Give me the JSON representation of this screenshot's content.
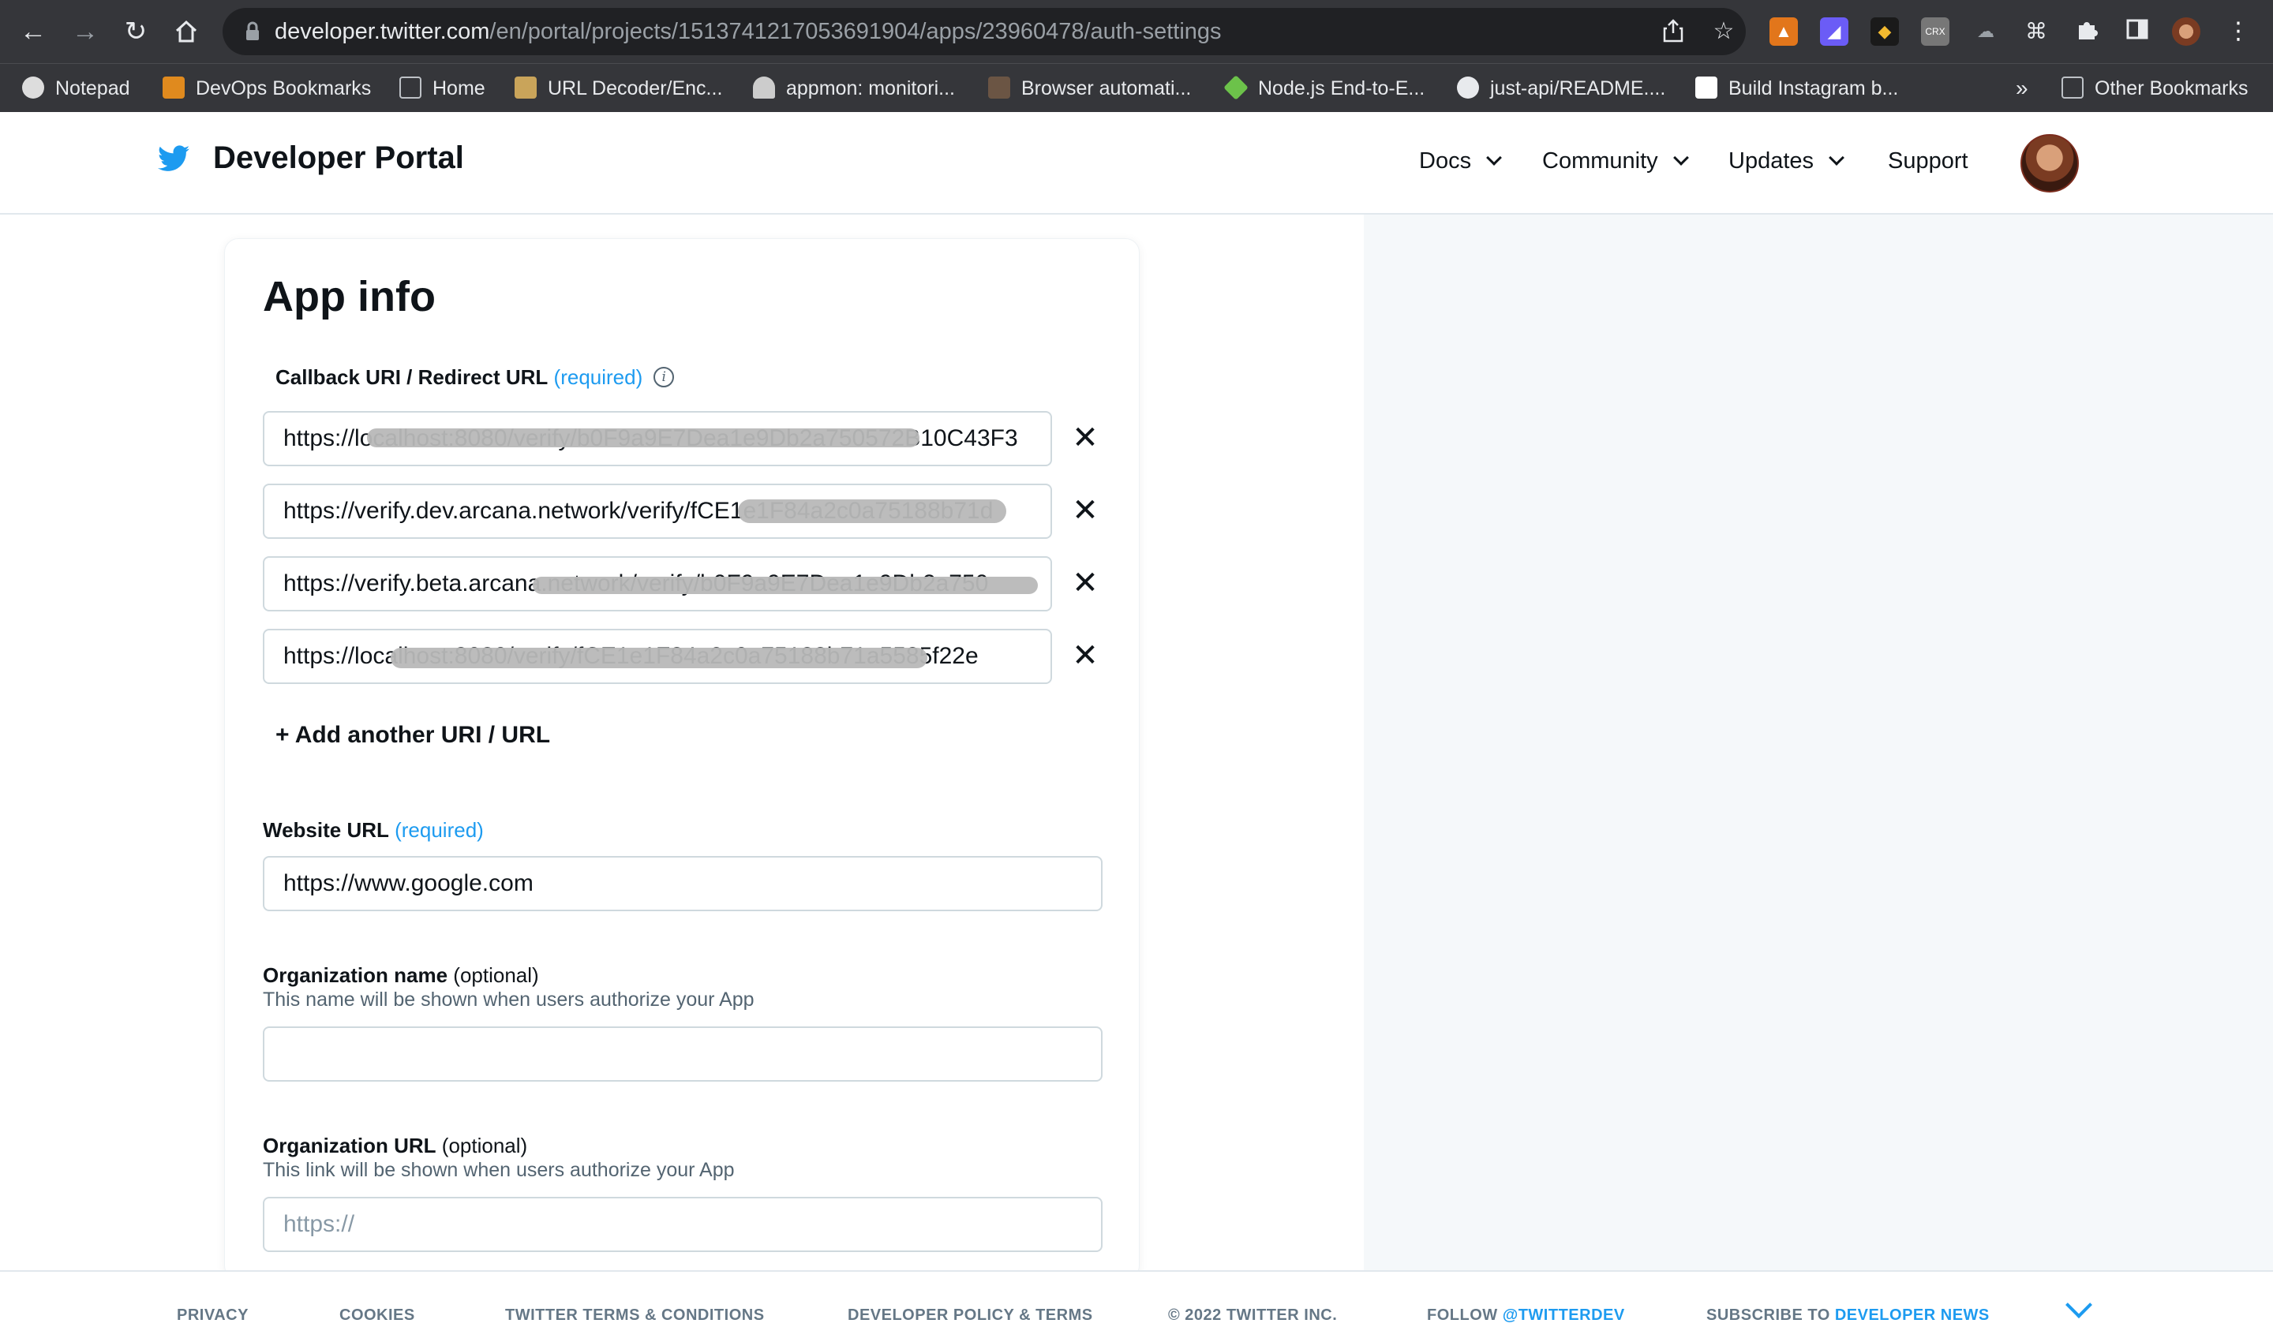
{
  "browser": {
    "url_host": "developer.twitter.com",
    "url_path": "/en/portal/projects/1513741217053691904/apps/23960478/auth-settings",
    "bookmarks": [
      {
        "label": "Notepad"
      },
      {
        "label": "DevOps Bookmarks"
      },
      {
        "label": "Home"
      },
      {
        "label": "URL Decoder/Enc..."
      },
      {
        "label": "appmon: monitori..."
      },
      {
        "label": "Browser automati..."
      },
      {
        "label": "Node.js End-to-E..."
      },
      {
        "label": "just-api/README...."
      },
      {
        "label": "Build Instagram b..."
      }
    ],
    "more_bookmarks": "»",
    "other_bookmarks": "Other Bookmarks"
  },
  "header": {
    "title": "Developer Portal",
    "nav": [
      {
        "label": "Docs"
      },
      {
        "label": "Community"
      },
      {
        "label": "Updates"
      },
      {
        "label": "Support"
      }
    ]
  },
  "app_info": {
    "title": "App info",
    "callback": {
      "label": "Callback URI / Redirect URL",
      "required": "(required)",
      "uris": [
        "https://localhost:8080/verify/b0F9a9E7Dea1e9Db2a750572B10C43F3",
        "https://verify.dev.arcana.network/verify/fCE1e1F84a2c0a75188b71d",
        "https://verify.beta.arcana.network/verify/b0F9a9E7Dea1e9Db2a750",
        "https://localhost:8080/verify/fCE1e1F84a2c0a75188b71a5585f22e"
      ],
      "add_label": "+ Add another URI / URL"
    },
    "website": {
      "label": "Website URL",
      "required": "(required)",
      "value": "https://www.google.com"
    },
    "org_name": {
      "label": "Organization name",
      "optional": "(optional)",
      "help": "This name will be shown when users authorize your App",
      "value": ""
    },
    "org_url": {
      "label": "Organization URL",
      "optional": "(optional)",
      "help": "This link will be shown when users authorize your App",
      "placeholder": "https://"
    }
  },
  "footer": {
    "privacy": "PRIVACY",
    "cookies": "COOKIES",
    "terms": "TWITTER TERMS & CONDITIONS",
    "policy": "DEVELOPER POLICY & TERMS",
    "copyright": "© 2022 TWITTER INC.",
    "follow": "FOLLOW",
    "follow_handle": "@TWITTERDEV",
    "subscribe": "SUBSCRIBE TO",
    "subscribe_target": "DEVELOPER NEWS"
  }
}
